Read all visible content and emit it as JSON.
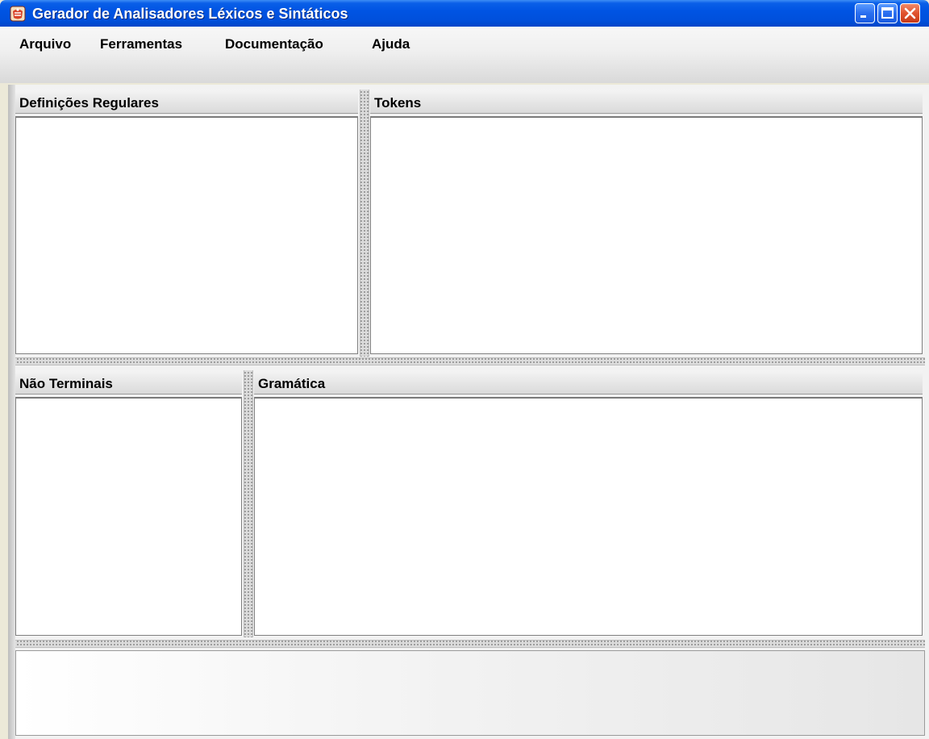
{
  "window": {
    "title": "Gerador de Analisadores Léxicos e Sintáticos",
    "icon": "app-gals-icon",
    "controls": [
      "minimize-icon",
      "maximize-icon",
      "close-icon"
    ]
  },
  "menu": {
    "items": [
      {
        "label": "Arquivo"
      },
      {
        "label": "Ferramentas"
      },
      {
        "label": "Documentação"
      },
      {
        "label": "Ajuda"
      }
    ]
  },
  "panes": {
    "regular_definitions": {
      "title": "Definições Regulares",
      "content": ""
    },
    "tokens": {
      "title": "Tokens",
      "content": ""
    },
    "non_terminals": {
      "title": "Não Terminais",
      "content": ""
    },
    "grammar": {
      "title": "Gramática",
      "content": ""
    },
    "output": {
      "content": ""
    }
  },
  "colors": {
    "titlebar": "#0054e3",
    "close_button": "#e0522e",
    "menubar": "#efefef",
    "editor_bg": "#ffffff"
  }
}
